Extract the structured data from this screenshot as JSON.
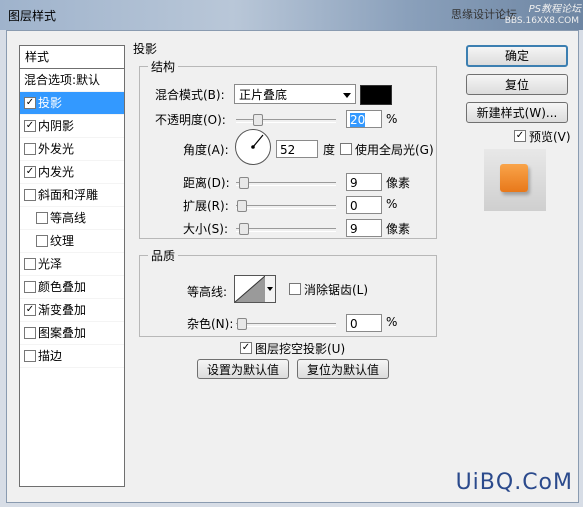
{
  "window": {
    "title": "图层样式",
    "watermark_top": "思缘设计论坛",
    "watermark_top2": "PS教程论坛",
    "watermark_top3": "BBS.16XX8.COM",
    "watermark_bottom": "UiBQ.CoM"
  },
  "left": {
    "header": "样式",
    "items": [
      {
        "label": "混合选项:默认",
        "checkbox": false,
        "checked": false,
        "selected": false,
        "indent": false
      },
      {
        "label": "投影",
        "checkbox": true,
        "checked": true,
        "selected": true,
        "indent": false
      },
      {
        "label": "内阴影",
        "checkbox": true,
        "checked": true,
        "selected": false,
        "indent": false
      },
      {
        "label": "外发光",
        "checkbox": true,
        "checked": false,
        "selected": false,
        "indent": false
      },
      {
        "label": "内发光",
        "checkbox": true,
        "checked": true,
        "selected": false,
        "indent": false
      },
      {
        "label": "斜面和浮雕",
        "checkbox": true,
        "checked": false,
        "selected": false,
        "indent": false
      },
      {
        "label": "等高线",
        "checkbox": true,
        "checked": false,
        "selected": false,
        "indent": true
      },
      {
        "label": "纹理",
        "checkbox": true,
        "checked": false,
        "selected": false,
        "indent": true
      },
      {
        "label": "光泽",
        "checkbox": true,
        "checked": false,
        "selected": false,
        "indent": false
      },
      {
        "label": "颜色叠加",
        "checkbox": true,
        "checked": false,
        "selected": false,
        "indent": false
      },
      {
        "label": "渐变叠加",
        "checkbox": true,
        "checked": true,
        "selected": false,
        "indent": false
      },
      {
        "label": "图案叠加",
        "checkbox": true,
        "checked": false,
        "selected": false,
        "indent": false
      },
      {
        "label": "描边",
        "checkbox": true,
        "checked": false,
        "selected": false,
        "indent": false
      }
    ]
  },
  "shadow": {
    "title": "投影",
    "structure_title": "结构",
    "blend_mode_label": "混合模式(B):",
    "blend_mode_value": "正片叠底",
    "blend_color": "#000000",
    "opacity_label": "不透明度(O):",
    "opacity_value": "20",
    "opacity_unit": "%",
    "angle_label": "角度(A):",
    "angle_value": "52",
    "angle_unit": "度",
    "global_light_label": "使用全局光(G)",
    "global_light_checked": false,
    "distance_label": "距离(D):",
    "distance_value": "9",
    "distance_unit": "像素",
    "spread_label": "扩展(R):",
    "spread_value": "0",
    "spread_unit": "%",
    "size_label": "大小(S):",
    "size_value": "9",
    "size_unit": "像素",
    "quality_title": "品质",
    "contour_label": "等高线:",
    "antialias_label": "消除锯齿(L)",
    "antialias_checked": false,
    "noise_label": "杂色(N):",
    "noise_value": "0",
    "noise_unit": "%",
    "knockout_label": "图层挖空投影(U)",
    "knockout_checked": true,
    "make_default_label": "设置为默认值",
    "reset_default_label": "复位为默认值"
  },
  "right": {
    "ok_label": "确定",
    "reset_label": "复位",
    "new_style_label": "新建样式(W)...",
    "preview_label": "预览(V)",
    "preview_checked": true,
    "preview_color": "#f08a2c"
  }
}
